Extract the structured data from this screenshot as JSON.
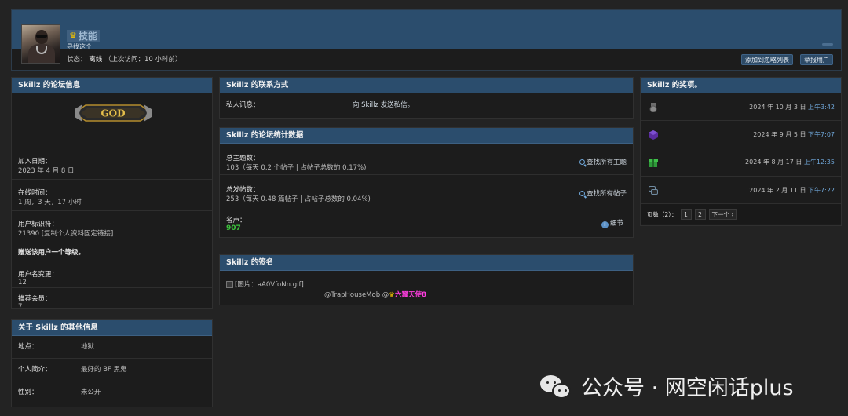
{
  "profile": {
    "username": "技能",
    "user_title": "寻找这个",
    "status_label": "状态：",
    "status_value": "离线",
    "last_visit": "（上次访问：10 小时前）",
    "add_friend_button": "添加到忽略列表",
    "report_button": "举报用户"
  },
  "forum_info": {
    "title": "Skillz 的论坛信息",
    "rank_badge": "GOD",
    "join_label": "加入日期：",
    "join_value": "2023 年 4 月 8 日",
    "online_label": "在线时间：",
    "online_value": "1 周，3 天，17 小时",
    "uid_label": "用户标识符：",
    "uid_value": "21390 [复制个人资料固定链接]",
    "gift_text": "赠送该用户一个等级。",
    "rename_label": "用户名变更：",
    "rename_value": "12",
    "referral_label": "推荐会员：",
    "referral_value": "7"
  },
  "other_info": {
    "title": "关于 Skillz 的其他信息",
    "location_label": "地点：",
    "location_value": "地狱",
    "bio_label": "个人简介：",
    "bio_value": "最好的 BF 黑鬼",
    "gender_label": "性别：",
    "gender_value": "未公开"
  },
  "contact": {
    "title": "Skillz 的联系方式",
    "pm_label": "私人讯息：",
    "pm_value": "向 Skillz 发送私信。"
  },
  "stats": {
    "title": "Skillz 的论坛统计数据",
    "threads_label": "总主题数：",
    "threads_value": "103（每天 0.2 个帖子 | 占帖子总数的 0.17%)",
    "threads_link": "查找所有主题",
    "posts_label": "总发帖数：",
    "posts_value": "253（每天 0.48 篇帖子 | 占帖子总数的 0.04%)",
    "posts_link": "查找所有帖子",
    "rep_label": "名声：",
    "rep_value": "907",
    "rep_link": "细节"
  },
  "signature": {
    "title": "Skillz 的签名",
    "image_alt": "[图片：aA0VfoNn.gif]",
    "handle": "@TrapHouseMob @",
    "handle_highlight": "六翼天使8"
  },
  "awards": {
    "title": "Skillz 的奖项。",
    "items": [
      {
        "icon": "medal-icon",
        "date": "2024 年 10 月 3 日",
        "time": "上午3:42",
        "color": "#8a8a8a"
      },
      {
        "icon": "purple-cube-icon",
        "date": "2024 年 9 月 5 日",
        "time": "下午7:07",
        "color": "#5a2ca0"
      },
      {
        "icon": "green-gift-icon",
        "date": "2024 年 8 月 17 日",
        "time": "上午12:35",
        "color": "#2f9a3a"
      },
      {
        "icon": "chat-bubble-icon",
        "date": "2024 年 2 月 11 日",
        "time": "下午7:22",
        "color": "#6f8aa0"
      }
    ],
    "pager_label": "页数（2）：",
    "pages": [
      "1",
      "2"
    ],
    "next_label": "下一个 ›"
  },
  "watermark": {
    "text": "公众号 · 网空闲话plus"
  }
}
